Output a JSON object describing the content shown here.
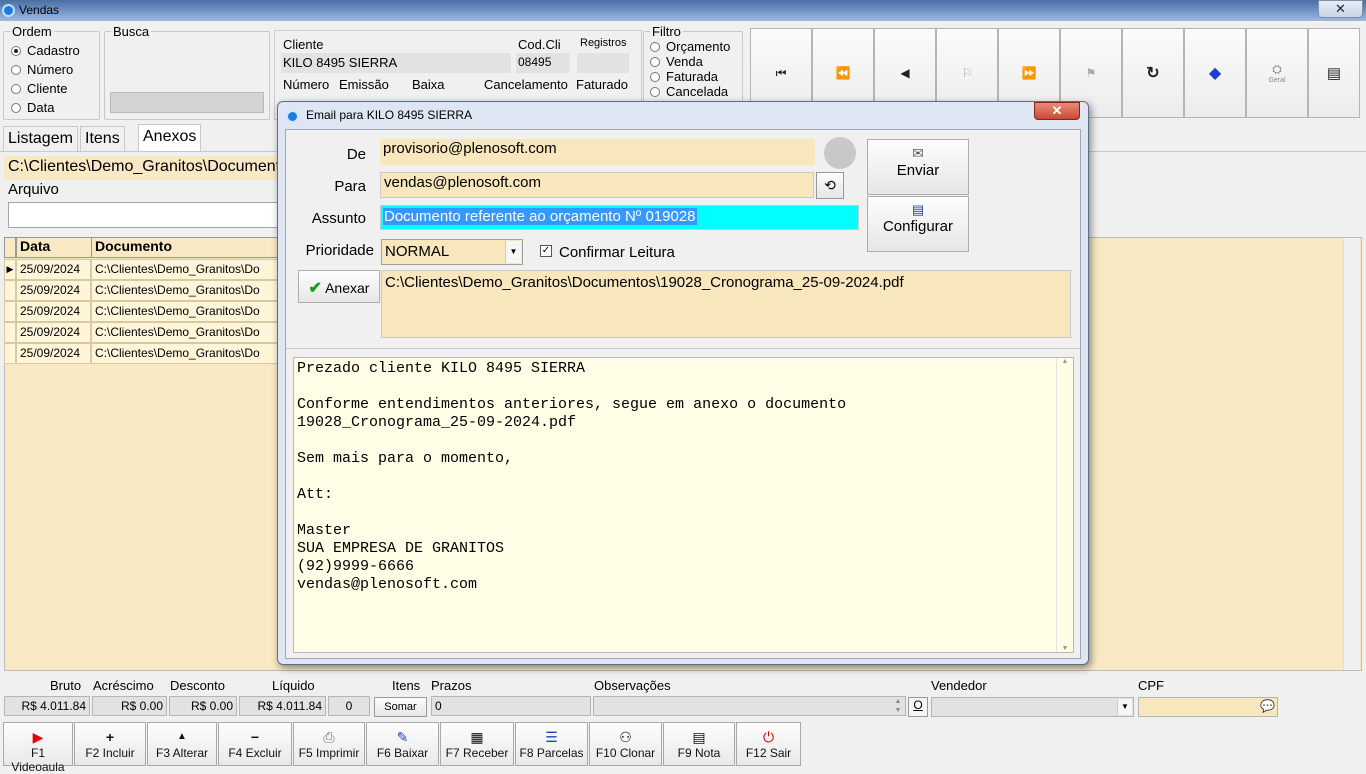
{
  "window": {
    "title": "Vendas",
    "close": "✕"
  },
  "ordem": {
    "legend": "Ordem",
    "options": [
      {
        "label": "Cadastro",
        "selected": true
      },
      {
        "label": "Número",
        "selected": false
      },
      {
        "label": "Cliente",
        "selected": false
      },
      {
        "label": "Data",
        "selected": false
      }
    ]
  },
  "busca": {
    "legend": "Busca"
  },
  "cliente": {
    "label": "Cliente",
    "value": "KILO 8495 SIERRA",
    "codcli_label": "Cod.Cli",
    "codcli_value": "08495",
    "registros_label": "Registros",
    "numero_label": "Número",
    "emissao_label": "Emissão",
    "baixa_label": "Baixa",
    "cancelamento_label": "Cancelamento",
    "faturado_label": "Faturado"
  },
  "filtro": {
    "legend": "Filtro",
    "options": [
      {
        "label": "Orçamento",
        "selected": false
      },
      {
        "label": "Venda",
        "selected": false
      },
      {
        "label": "Faturada",
        "selected": false
      },
      {
        "label": "Cancelada",
        "selected": false
      }
    ]
  },
  "nav": {
    "icons": [
      "first-icon",
      "prev-page-icon",
      "prev-icon",
      "next-icon",
      "next-page-icon",
      "last-icon",
      "refresh-icon",
      "tag-icon",
      "gear-icon",
      "report-icon"
    ],
    "glyphs": [
      "⏮",
      "⏪",
      "◀",
      "⚐",
      "⏩",
      "⚑",
      "↻",
      "◆",
      "⛭",
      "▤"
    ],
    "settings_label": "Geral"
  },
  "tabs": [
    {
      "label": "Listagem"
    },
    {
      "label": "Itens"
    },
    {
      "label": "Anexos"
    }
  ],
  "anexos": {
    "path": "C:\\Clientes\\Demo_Granitos\\Document",
    "arquivo_label": "Arquivo"
  },
  "grid": {
    "headers": [
      "Data",
      "Documento"
    ],
    "rows": [
      [
        "25/09/2024",
        "C:\\Clientes\\Demo_Granitos\\Do"
      ],
      [
        "25/09/2024",
        "C:\\Clientes\\Demo_Granitos\\Do"
      ],
      [
        "25/09/2024",
        "C:\\Clientes\\Demo_Granitos\\Do"
      ],
      [
        "25/09/2024",
        "C:\\Clientes\\Demo_Granitos\\Do"
      ],
      [
        "25/09/2024",
        "C:\\Clientes\\Demo_Granitos\\Do"
      ]
    ]
  },
  "dialog": {
    "title": "Email para KILO 8495 SIERRA",
    "close": "✕",
    "de_label": "De",
    "de_value": "provisorio@plenosoft.com",
    "para_label": "Para",
    "para_value": "vendas@plenosoft.com",
    "assunto_label": "Assunto",
    "assunto_value": "Documento referente ao orçamento Nº 019028",
    "prioridade_label": "Prioridade",
    "prioridade_value": "NORMAL",
    "confirmar_label": "Confirmar Leitura",
    "confirmar_checked": true,
    "enviar_label": "Enviar",
    "configurar_label": "Configurar",
    "anexar_label": "Anexar",
    "attachment": "C:\\Clientes\\Demo_Granitos\\Documentos\\19028_Cronograma_25-09-2024.pdf",
    "body": "Prezado cliente KILO 8495 SIERRA\n\nConforme entendimentos anteriores, segue em anexo o documento\n19028_Cronograma_25-09-2024.pdf\n\nSem mais para o momento,\n\nAtt:\n\nMaster\nSUA EMPRESA DE GRANITOS\n(92)9999-6666\nvendas@plenosoft.com"
  },
  "totals": {
    "bruto_label": "Bruto",
    "bruto": "R$ 4.011.84",
    "acrescimo_label": "Acréscimo",
    "acrescimo": "R$ 0.00",
    "desconto_label": "Desconto",
    "desconto": "R$ 0.00",
    "liquido_label": "Líquido",
    "liquido": "R$ 4.011.84",
    "itens_label": "Itens",
    "itens": "0",
    "somar": "Somar",
    "prazos_label": "Prazos",
    "prazos": "0",
    "obs_label": "Observações",
    "obs_btn": "O",
    "vendedor_label": "Vendedor",
    "cpf_label": "CPF"
  },
  "fkeys": [
    {
      "label": "F1 Videoaula",
      "icon": "video-icon",
      "glyph": "▶"
    },
    {
      "label": "F2 Incluir",
      "icon": "plus-icon",
      "glyph": "+"
    },
    {
      "label": "F3 Alterar",
      "icon": "up-icon",
      "glyph": "▲"
    },
    {
      "label": "F4 Excluir",
      "icon": "minus-icon",
      "glyph": "−"
    },
    {
      "label": "F5 Imprimir",
      "icon": "printer-icon",
      "glyph": "⎙"
    },
    {
      "label": "F6 Baixar",
      "icon": "check-doc-icon",
      "glyph": "✎"
    },
    {
      "label": "F7 Receber",
      "icon": "receipt-icon",
      "glyph": "▦"
    },
    {
      "label": "F8 Parcelas",
      "icon": "list-icon",
      "glyph": "☰"
    },
    {
      "label": "F10 Clonar",
      "icon": "clone-icon",
      "glyph": "⚇"
    },
    {
      "label": "F9 Nota",
      "icon": "note-icon",
      "glyph": "▤"
    },
    {
      "label": "F12 Sair",
      "icon": "exit-icon",
      "glyph": "⏻"
    }
  ],
  "colors": {
    "accent_yellow": "#f8e6bc",
    "selection_cyan": "#00ffff",
    "dialog_close": "#c94a33"
  }
}
